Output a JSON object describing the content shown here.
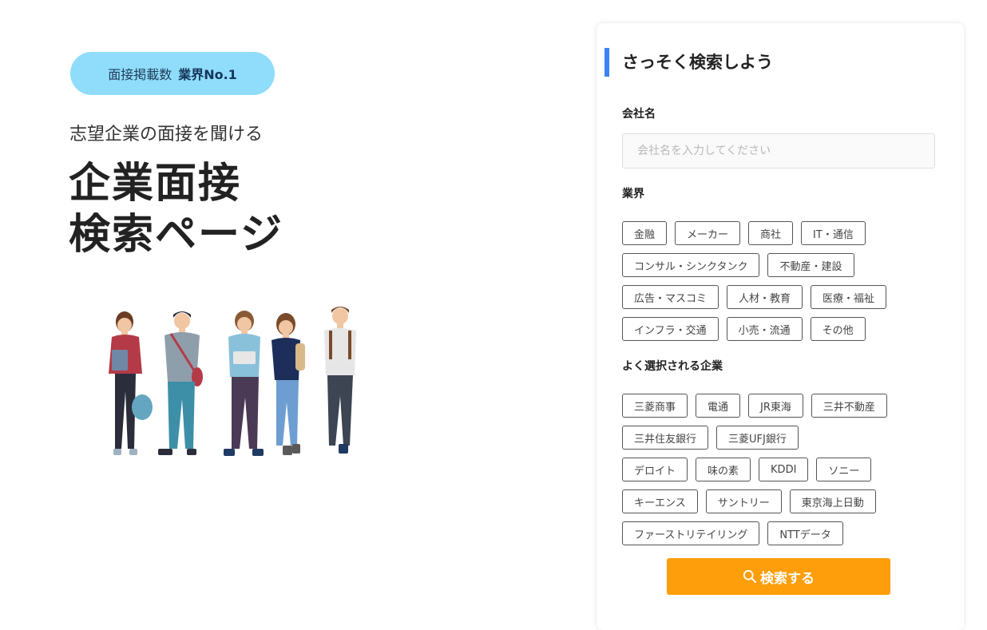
{
  "hero": {
    "badge_text": "面接掲載数",
    "badge_strong": "業界No.1",
    "subtitle": "志望企業の面接を聞ける",
    "title_line1": "企業面接",
    "title_line2": "検索ページ"
  },
  "search": {
    "heading": "さっそく検索しよう",
    "company_label": "会社名",
    "company_placeholder": "会社名を入力してください",
    "company_value": "",
    "industry_label": "業界",
    "industries": [
      [
        "金融",
        "メーカー",
        "商社",
        "IT・通信"
      ],
      [
        "コンサル・シンクタンク",
        "不動産・建設"
      ],
      [
        "広告・マスコミ",
        "人材・教育",
        "医療・福祉"
      ],
      [
        "インフラ・交通",
        "小売・流通",
        "その他"
      ]
    ],
    "popular_label": "よく選択される企業",
    "companies": [
      [
        "三菱商事",
        "電通",
        "JR東海",
        "三井不動産"
      ],
      [
        "三井住友銀行",
        "三菱UFJ銀行"
      ],
      [
        "デロイト",
        "味の素",
        "KDDI",
        "ソニー"
      ],
      [
        "キーエンス",
        "サントリー",
        "東京海上日動"
      ],
      [
        "ファーストリテイリング",
        "NTTデータ"
      ]
    ],
    "submit_label": "検索する",
    "submit_icon": "search-icon"
  },
  "colors": {
    "badge_bg": "#8fdcfb",
    "heading_accent": "#3b82f6",
    "button_bg": "#fd9e0a"
  }
}
